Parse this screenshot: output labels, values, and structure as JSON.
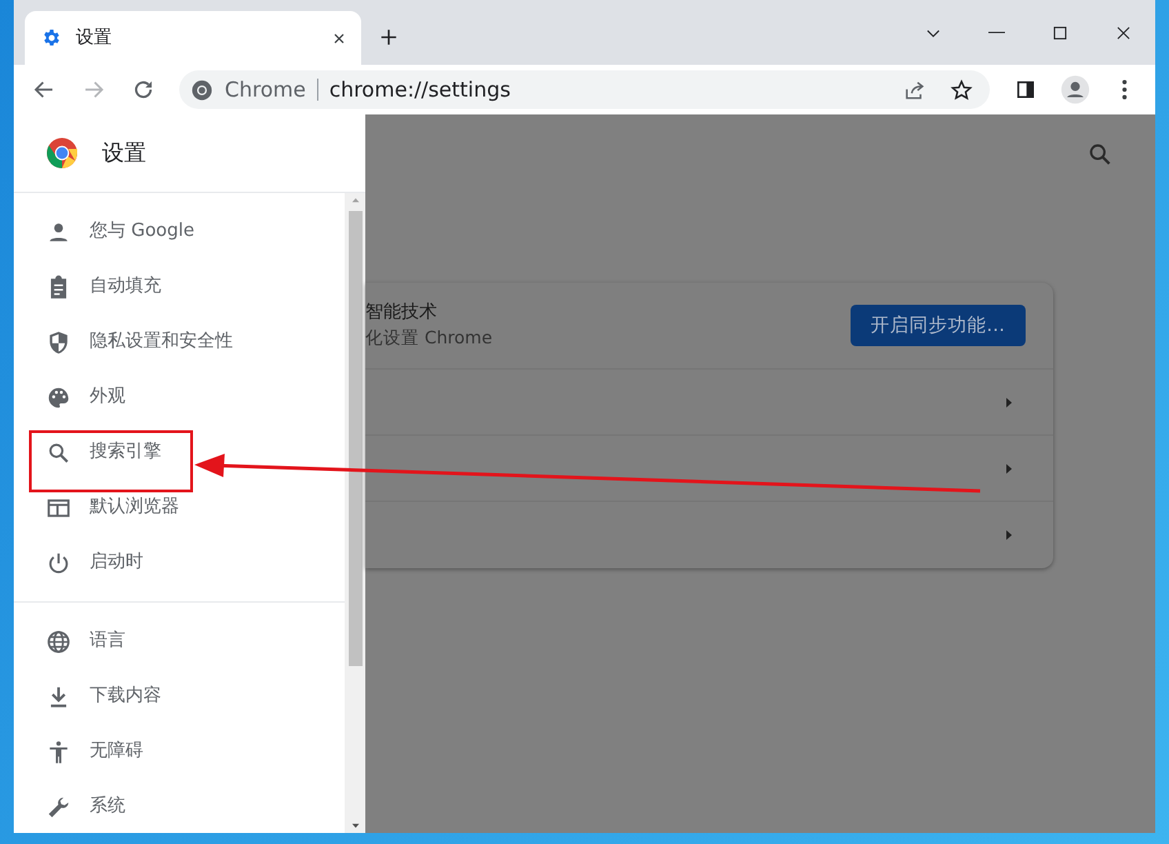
{
  "tab": {
    "title": "设置",
    "selected": true
  },
  "toolbar": {
    "back_disabled": false,
    "forward_disabled": true,
    "scheme_label": "Chrome",
    "url": "chrome://settings"
  },
  "drawer": {
    "title": "设置",
    "groups": [
      {
        "items": [
          "您与 Google",
          "自动填充",
          "隐私设置和安全性",
          "外观",
          "搜索引擎",
          "默认浏览器",
          "启动时"
        ]
      },
      {
        "items": [
          "语言",
          "下载内容",
          "无障碍",
          "系统"
        ]
      }
    ]
  },
  "sync_card": {
    "title": "智能技术",
    "subtitle": "化设置 Chrome",
    "button": "开启同步功能…"
  }
}
